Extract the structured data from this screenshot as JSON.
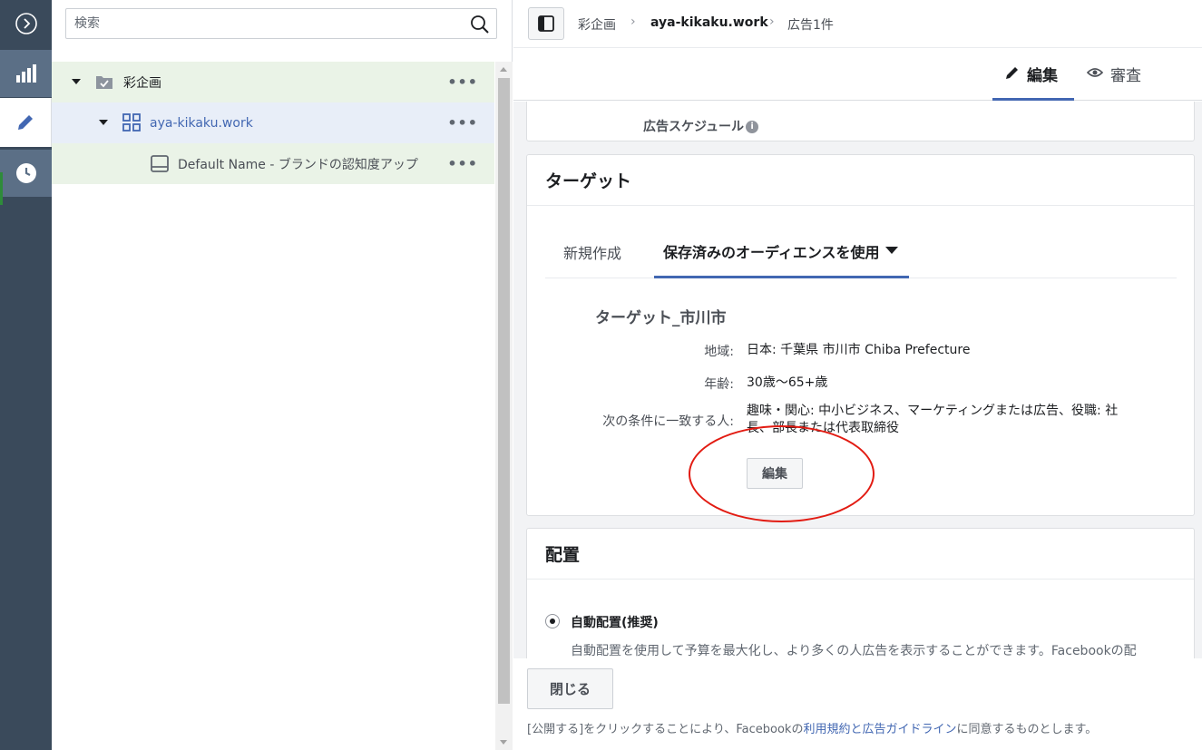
{
  "rail": {
    "items": [
      "expand",
      "reports",
      "edit",
      "history"
    ]
  },
  "tree": {
    "search_placeholder": "検索",
    "rows": [
      {
        "label": "彩企画",
        "more": "•••"
      },
      {
        "label": "aya-kikaku.work",
        "more": "•••"
      },
      {
        "label": "Default Name - ブランドの認知度アップ",
        "more": "•••"
      }
    ]
  },
  "breadcrumb": {
    "items": [
      "彩企画",
      "aya-kikaku.work",
      "広告1件"
    ]
  },
  "top_tabs": {
    "edit": "編集",
    "review": "審査"
  },
  "schedule": {
    "label": "広告スケジュール"
  },
  "target": {
    "heading": "ターゲット",
    "tab_new": "新規作成",
    "tab_saved": "保存済みのオーディエンスを使用",
    "audience_name": "ターゲット_市川市",
    "fields": [
      {
        "key": "地域:",
        "value": "日本: 千葉県 市川市 Chiba Prefecture"
      },
      {
        "key": "年齢:",
        "value": "30歳～65+歳"
      },
      {
        "key": "次の条件に一致する人:",
        "value_line1": "趣味・関心: 中小ビジネス、マーケティングまたは広告、役職: 社",
        "value_line2": "長、部長または代表取締役"
      }
    ],
    "edit_button": "編集"
  },
  "placement": {
    "heading": "配置",
    "auto_label": "自動配置(推奨)",
    "auto_desc": "自動配置を使用して予算を最大化し、より多くの人広告を表示することができます。Facebookの配"
  },
  "footer": {
    "close_button": "閉じる",
    "terms_prefix": "[公開する]をクリックすることにより、Facebookの",
    "terms_link1": "利用規約",
    "terms_and": "と",
    "terms_link2": "広告ガイドライン",
    "terms_suffix": "に同意するものとします。"
  },
  "colors": {
    "accent": "#4267b2",
    "rail": "#3a4a5b",
    "highlight": "#e21b12"
  }
}
